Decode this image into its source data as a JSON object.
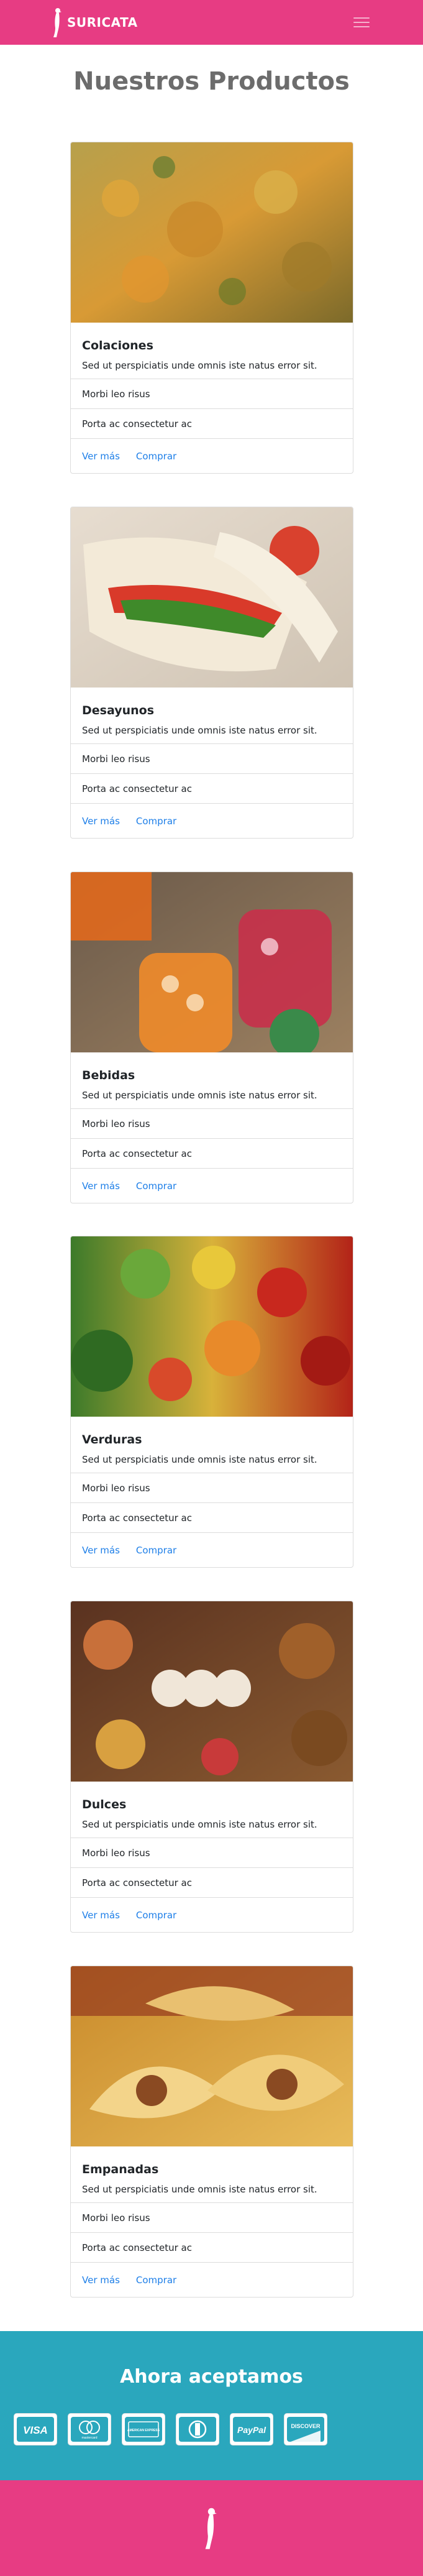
{
  "brand": {
    "name": "SURICATA"
  },
  "page_title": "Nuestros Productos",
  "colors": {
    "primary": "#e73c83",
    "secondary": "#2aa7bd",
    "link": "#1e7fe8"
  },
  "products": [
    {
      "title": "Colaciones",
      "text": "Sed ut perspiciatis unde omnis iste natus error sit.",
      "item1": "Morbi leo risus",
      "item2": "Porta ac consectetur ac",
      "link1": "Ver más",
      "link2": "Comprar"
    },
    {
      "title": "Desayunos",
      "text": "Sed ut perspiciatis unde omnis iste natus error sit.",
      "item1": "Morbi leo risus",
      "item2": "Porta ac consectetur ac",
      "link1": "Ver más",
      "link2": "Comprar"
    },
    {
      "title": "Bebidas",
      "text": "Sed ut perspiciatis unde omnis iste natus error sit.",
      "item1": "Morbi leo risus",
      "item2": "Porta ac consectetur ac",
      "link1": "Ver más",
      "link2": "Comprar"
    },
    {
      "title": "Verduras",
      "text": "Sed ut perspiciatis unde omnis iste natus error sit.",
      "item1": "Morbi leo risus",
      "item2": "Porta ac consectetur ac",
      "link1": "Ver más",
      "link2": "Comprar"
    },
    {
      "title": "Dulces",
      "text": "Sed ut perspiciatis unde omnis iste natus error sit.",
      "item1": "Morbi leo risus",
      "item2": "Porta ac consectetur ac",
      "link1": "Ver más",
      "link2": "Comprar"
    },
    {
      "title": "Empanadas",
      "text": "Sed ut perspiciatis unde omnis iste natus error sit.",
      "item1": "Morbi leo risus",
      "item2": "Porta ac consectetur ac",
      "link1": "Ver más",
      "link2": "Comprar"
    }
  ],
  "payments": {
    "title": "Ahora aceptamos",
    "methods": [
      {
        "name": "VISA",
        "icon": "visa-icon"
      },
      {
        "name": "mastercard",
        "icon": "mastercard-icon"
      },
      {
        "name": "AMERICAN EXPRESS",
        "icon": "amex-icon"
      },
      {
        "name": "Diners",
        "icon": "diners-icon"
      },
      {
        "name": "PayPal",
        "icon": "paypal-icon"
      },
      {
        "name": "DISCOVER",
        "icon": "discover-icon"
      }
    ]
  }
}
